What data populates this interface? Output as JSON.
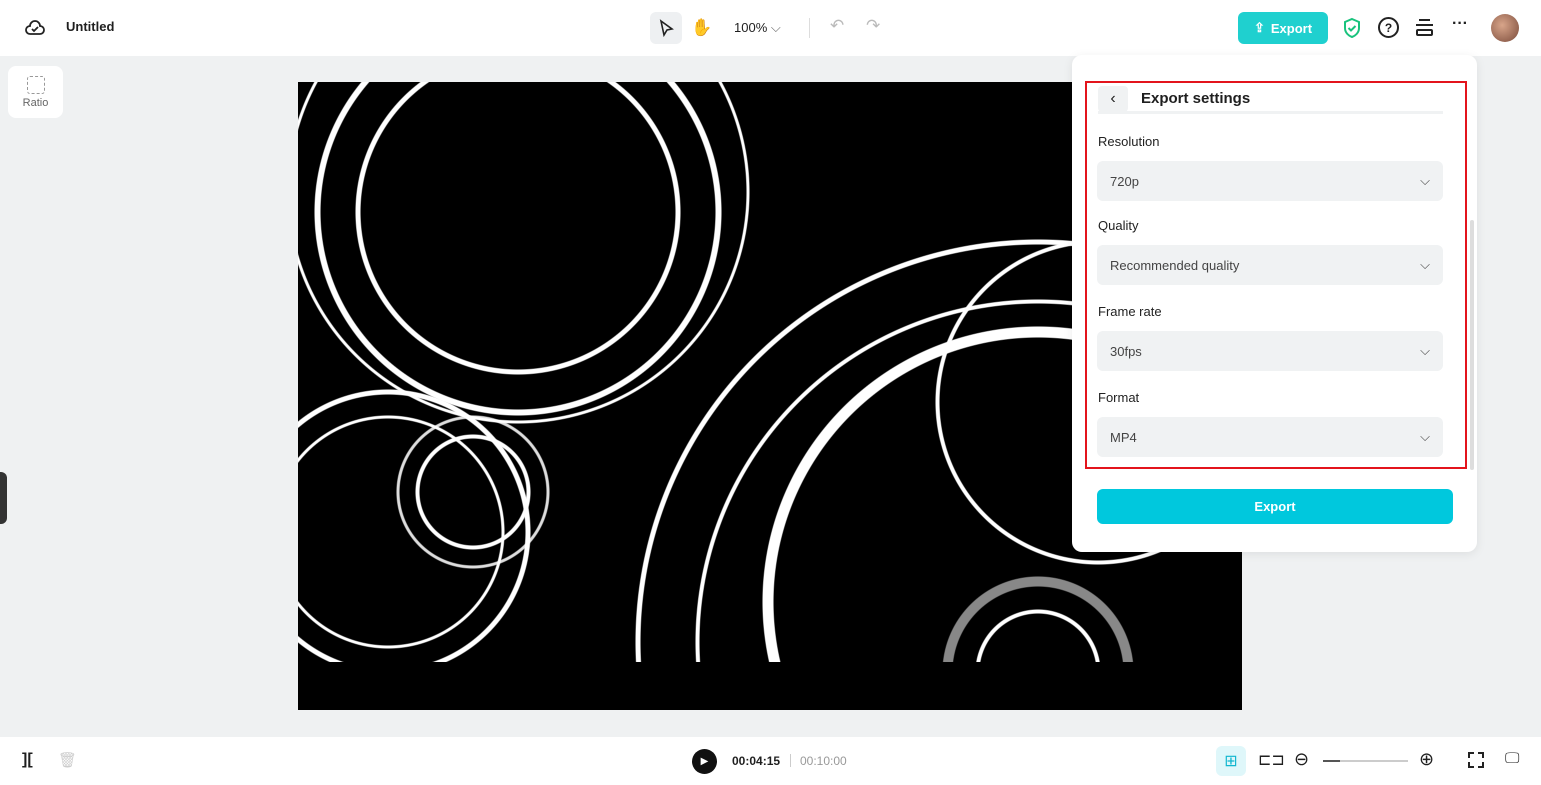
{
  "header": {
    "title": "Untitled",
    "zoom": "100%",
    "export_label": "Export"
  },
  "sidebar": {
    "ratio_label": "Ratio"
  },
  "export_panel": {
    "title": "Export settings",
    "fields": [
      {
        "label": "Resolution",
        "value": "720p"
      },
      {
        "label": "Quality",
        "value": "Recommended quality"
      },
      {
        "label": "Frame rate",
        "value": "30fps"
      },
      {
        "label": "Format",
        "value": "MP4"
      }
    ],
    "export_button": "Export"
  },
  "playback": {
    "current_time": "00:04:15",
    "total_time": "00:10:00",
    "zoom_fraction": 0.2
  },
  "colors": {
    "accent": "#1fd0cf",
    "export_button": "#00c8dd",
    "highlight": "#e3141c"
  }
}
